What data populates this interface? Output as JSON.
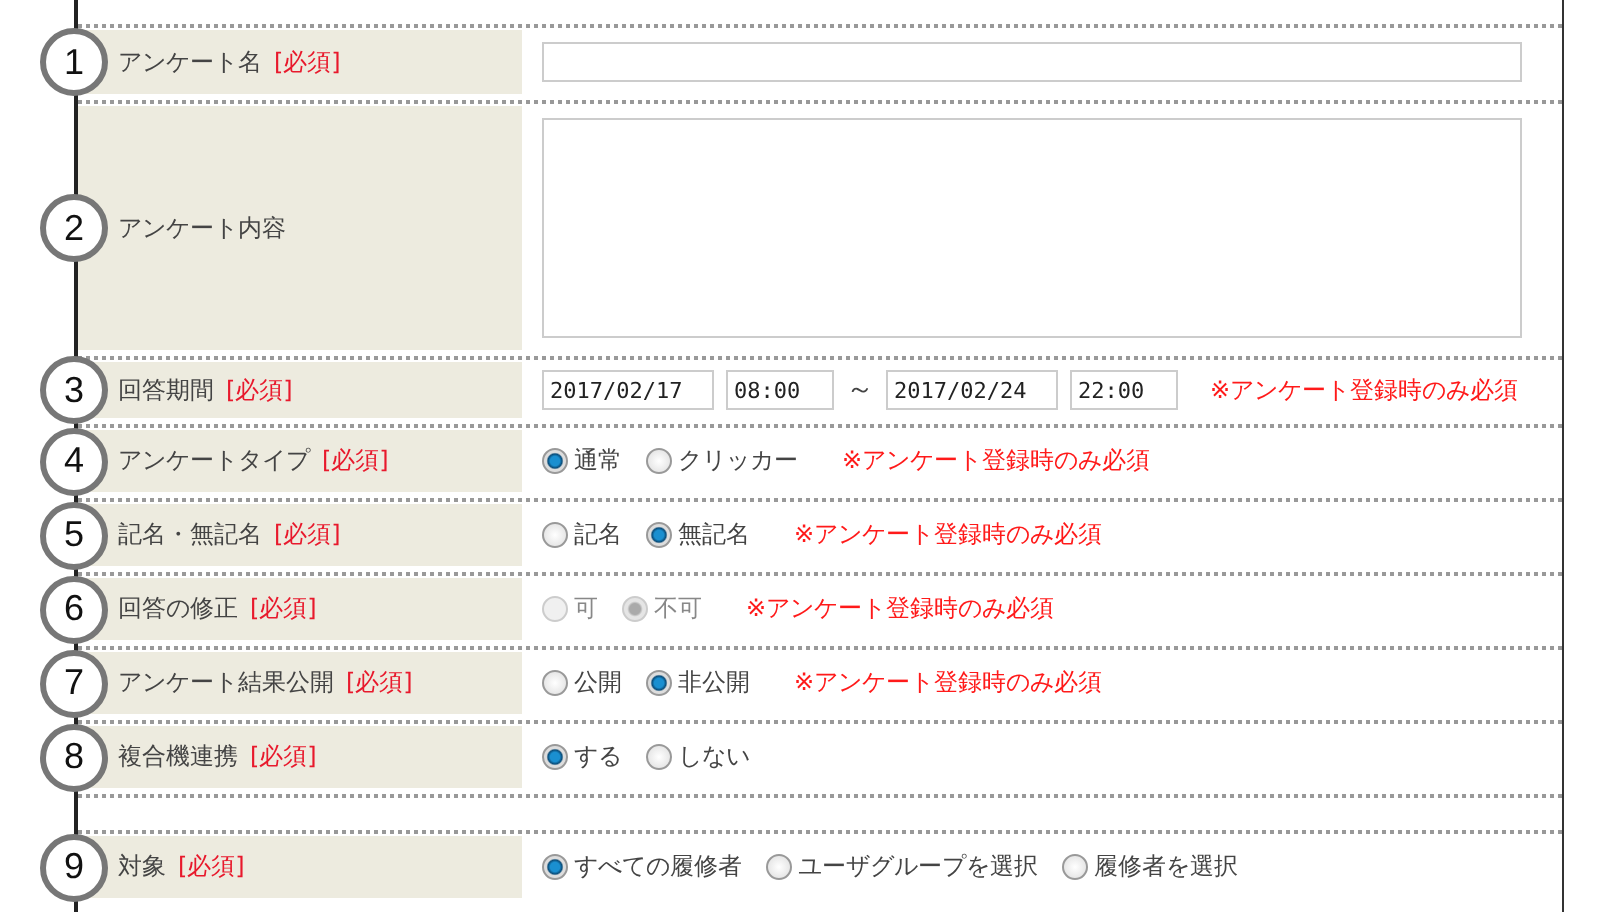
{
  "rows": [
    {
      "number": "1",
      "label": "アンケート名",
      "required": "[必須]",
      "kind": "text"
    },
    {
      "number": "2",
      "label": "アンケート内容",
      "kind": "textarea"
    },
    {
      "number": "3",
      "label": "回答期間",
      "required": "[必須]",
      "kind": "period",
      "start_date": "2017/02/17",
      "start_time": "08:00",
      "separator": "～",
      "end_date": "2017/02/24",
      "end_time": "22:00",
      "note": "※アンケート登録時のみ必須"
    },
    {
      "number": "4",
      "label": "アンケートタイプ",
      "required": "[必須]",
      "kind": "radio",
      "disabled": false,
      "options": [
        {
          "label": "通常",
          "selected": true
        },
        {
          "label": "クリッカー",
          "selected": false
        }
      ],
      "note": "※アンケート登録時のみ必須"
    },
    {
      "number": "5",
      "label": "記名・無記名",
      "required": "[必須]",
      "kind": "radio",
      "disabled": false,
      "options": [
        {
          "label": "記名",
          "selected": false
        },
        {
          "label": "無記名",
          "selected": true
        }
      ],
      "note": "※アンケート登録時のみ必須"
    },
    {
      "number": "6",
      "label": "回答の修正",
      "required": "[必須]",
      "kind": "radio",
      "disabled": true,
      "options": [
        {
          "label": "可",
          "selected": false
        },
        {
          "label": "不可",
          "selected": true
        }
      ],
      "note": "※アンケート登録時のみ必須"
    },
    {
      "number": "7",
      "label": "アンケート結果公開",
      "required": "[必須]",
      "kind": "radio",
      "disabled": false,
      "options": [
        {
          "label": "公開",
          "selected": false
        },
        {
          "label": "非公開",
          "selected": true
        }
      ],
      "note": "※アンケート登録時のみ必須"
    },
    {
      "number": "8",
      "label": "複合機連携",
      "required": "[必須]",
      "kind": "radio",
      "disabled": false,
      "options": [
        {
          "label": "する",
          "selected": true
        },
        {
          "label": "しない",
          "selected": false
        }
      ]
    },
    {
      "kind": "spacer"
    },
    {
      "number": "9",
      "label": "対象",
      "required": "[必須]",
      "kind": "radio",
      "disabled": false,
      "options": [
        {
          "label": "すべての履修者",
          "selected": true
        },
        {
          "label": "ユーザグループを選択",
          "selected": false
        },
        {
          "label": "履修者を選択",
          "selected": false
        }
      ]
    }
  ]
}
